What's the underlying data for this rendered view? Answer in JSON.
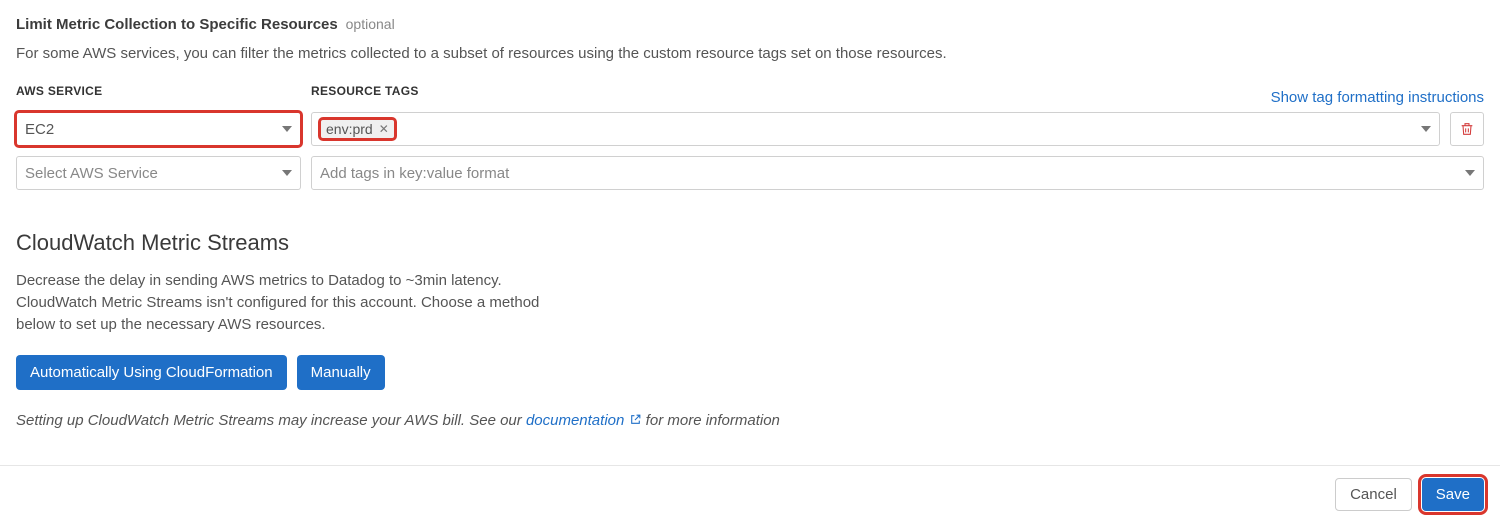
{
  "section": {
    "title": "Limit Metric Collection to Specific Resources",
    "optional": "optional",
    "description": "For some AWS services, you can filter the metrics collected to a subset of resources using the custom resource tags set on those resources."
  },
  "labels": {
    "aws_service": "AWS SERVICE",
    "resource_tags": "RESOURCE TAGS",
    "show_instructions": "Show tag formatting instructions"
  },
  "row1": {
    "service_value": "EC2",
    "tag_value": "env:prd"
  },
  "row2": {
    "service_placeholder": "Select AWS Service",
    "tags_placeholder": "Add tags in key:value format"
  },
  "cloudwatch": {
    "heading": "CloudWatch Metric Streams",
    "line1": "Decrease the delay in sending AWS metrics to Datadog to ~3min latency.",
    "line2": "CloudWatch Metric Streams isn't configured for this account. Choose a method below to set up the necessary AWS resources.",
    "btn_auto": "Automatically Using CloudFormation",
    "btn_manual": "Manually",
    "note_prefix": "Setting up CloudWatch Metric Streams may increase your AWS bill. See our ",
    "note_link": "documentation",
    "note_suffix": " for more information"
  },
  "footer": {
    "cancel": "Cancel",
    "save": "Save"
  }
}
